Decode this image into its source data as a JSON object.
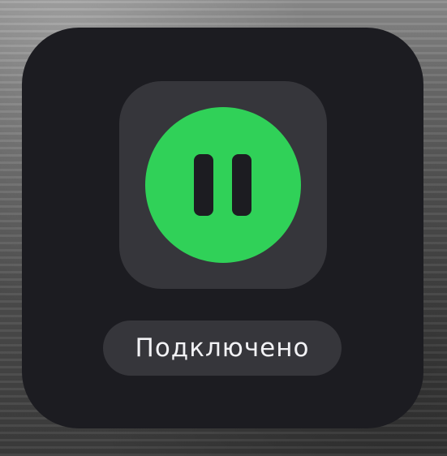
{
  "panel": {
    "toggle_state": "paused",
    "toggle_icon": "pause-icon",
    "status_label": "Подключено"
  },
  "colors": {
    "panel_background": "#1c1c21",
    "tile_background": "#36363b",
    "accent_green": "#30d158",
    "pause_bars": "#1c1c21",
    "status_text": "#f2f2f5"
  }
}
